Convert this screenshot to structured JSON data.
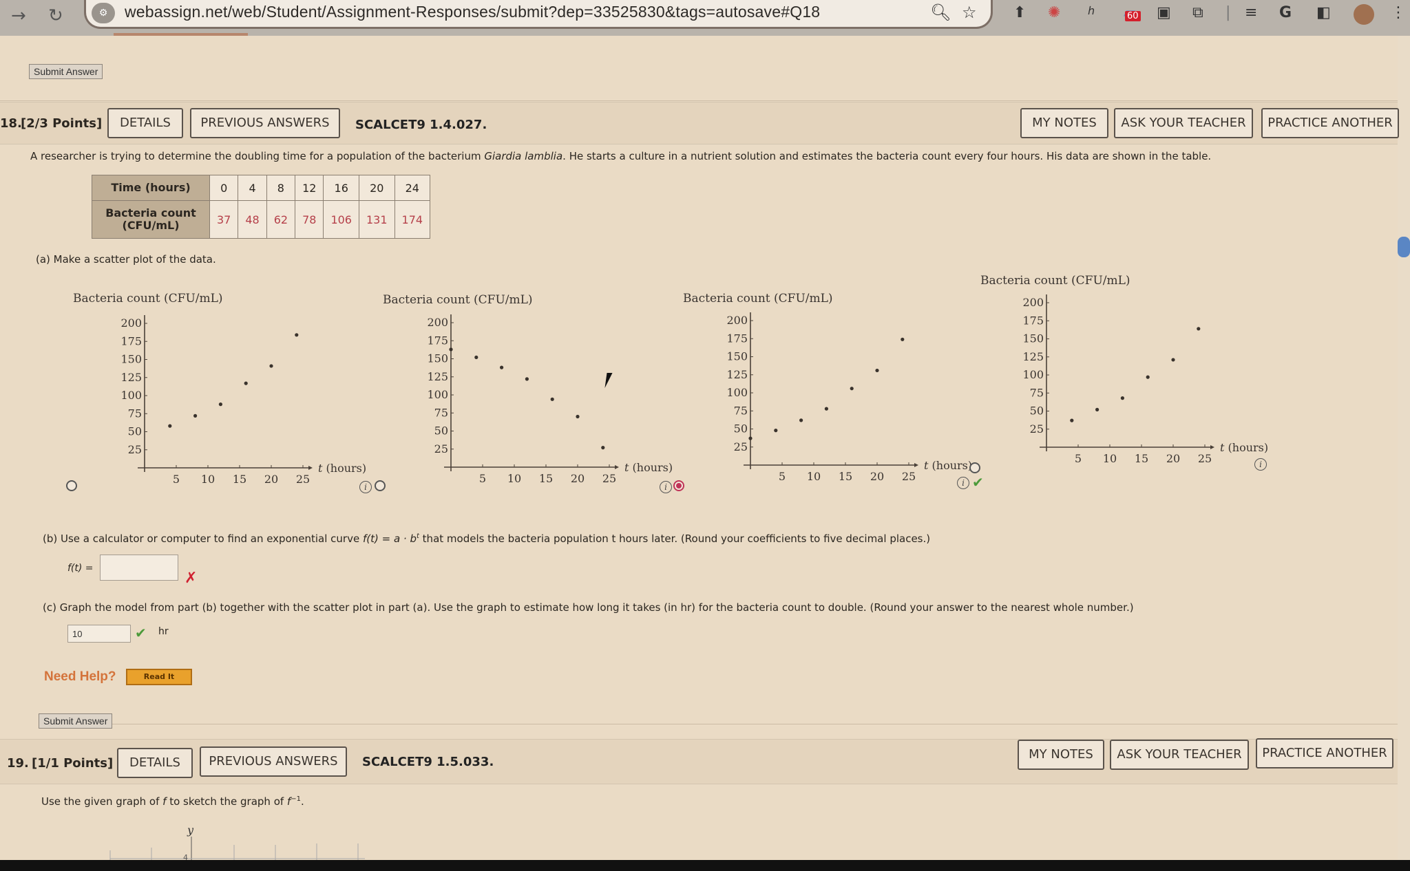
{
  "browser": {
    "url": "webassign.net/web/Student/Assignment-Responses/submit?dep=33525830&tags=autosave#Q18",
    "icons": [
      "back-icon",
      "reload-icon",
      "site-settings-icon",
      "zoom-icon",
      "bookmark-star-icon"
    ],
    "extensions": [
      "upload-extension-icon",
      "pc-extension-icon",
      "script-extension-icon",
      "extension-badge-icon",
      "camera-extension-icon",
      "puzzle-extensions-icon",
      "reading-list-icon",
      "google-icon",
      "sidepanel-icon",
      "profile-avatar",
      "menu-dots-icon"
    ],
    "ext_badge": "60"
  },
  "top": {
    "submit_label": "Submit Answer"
  },
  "q18": {
    "number": "18.",
    "points": "[2/3 Points]",
    "details_label": "DETAILS",
    "prev_label": "PREVIOUS ANSWERS",
    "code": "SCALCET9 1.4.027.",
    "my_notes": "MY NOTES",
    "ask_teacher": "ASK YOUR TEACHER",
    "practice": "PRACTICE ANOTHER",
    "intro_pre": "A researcher is trying to determine the doubling time for a population of the bacterium ",
    "intro_species": "Giardia lamblia",
    "intro_post": ". He starts a culture in a nutrient solution and estimates the bacteria count every four hours. His data are shown in the table.",
    "table": {
      "row1_header": "Time (hours)",
      "row2_header_l1": "Bacteria count",
      "row2_header_l2": "(CFU/mL)",
      "times": [
        "0",
        "4",
        "8",
        "12",
        "16",
        "20",
        "24"
      ],
      "counts": [
        "37",
        "48",
        "62",
        "78",
        "106",
        "131",
        "174"
      ]
    },
    "part_a": "(a)   Make a scatter plot of the data.",
    "part_b_pre": "(b)   Use a calculator or computer to find an exponential curve ",
    "part_b_formula": "f(t) = a · b",
    "part_b_sup": "t",
    "part_b_post": " that models the bacteria population t hours later. (Round your coefficients to five decimal places.)",
    "part_b_label": "f(t) =",
    "part_b_value": "",
    "part_b_status": "✗",
    "part_c": "(c)   Graph the model from part (b) together with the scatter plot in part (a). Use the graph to estimate how long it takes (in hr) for the bacteria count to double. (Round your answer to the nearest whole number.)",
    "part_c_value": "10",
    "part_c_status": "✔",
    "part_c_unit": "hr",
    "need_help": "Need Help?",
    "read_it": "Read It",
    "submit_label": "Submit Answer"
  },
  "q19": {
    "number": "19.",
    "points": "[1/1 Points]",
    "details_label": "DETAILS",
    "prev_label": "PREVIOUS ANSWERS",
    "code": "SCALCET9 1.5.033.",
    "my_notes": "MY NOTES",
    "ask_teacher": "ASK YOUR TEACHER",
    "practice": "PRACTICE ANOTHER",
    "prompt_pre": "Use the given graph of ",
    "prompt_f": "f",
    "prompt_mid": " to sketch the graph of ",
    "prompt_finv": "f",
    "prompt_sup": "−1",
    "prompt_end": ".",
    "graph_y_label": "y",
    "graph_tick": "4"
  },
  "chart_data": [
    {
      "type": "scatter",
      "title": "Bacteria count (CFU/mL)",
      "xlabel": "t (hours)",
      "x_ticks": [
        "5",
        "10",
        "15",
        "20",
        "25"
      ],
      "y_ticks": [
        "25",
        "50",
        "75",
        "100",
        "125",
        "150",
        "175",
        "200"
      ],
      "xlim": [
        0,
        25
      ],
      "ylim": [
        0,
        200
      ],
      "x": [
        4,
        8,
        12,
        16,
        20,
        24
      ],
      "y": [
        58,
        72,
        88,
        117,
        141,
        184
      ],
      "selected": false,
      "status": ""
    },
    {
      "type": "scatter",
      "title": "Bacteria count (CFU/mL)",
      "xlabel": "t (hours)",
      "x_ticks": [
        "5",
        "10",
        "15",
        "20",
        "25"
      ],
      "y_ticks": [
        "25",
        "50",
        "75",
        "100",
        "125",
        "150",
        "175",
        "200"
      ],
      "xlim": [
        0,
        25
      ],
      "ylim": [
        0,
        200
      ],
      "x": [
        0,
        4,
        8,
        12,
        16,
        20,
        24
      ],
      "y": [
        163,
        152,
        138,
        122,
        94,
        70,
        27
      ],
      "selected": false,
      "status": ""
    },
    {
      "type": "scatter",
      "title": "Bacteria count (CFU/mL)",
      "xlabel": "t (hours)",
      "x_ticks": [
        "5",
        "10",
        "15",
        "20",
        "25"
      ],
      "y_ticks": [
        "25",
        "50",
        "75",
        "100",
        "125",
        "150",
        "175",
        "200"
      ],
      "xlim": [
        0,
        25
      ],
      "ylim": [
        0,
        200
      ],
      "x": [
        0,
        4,
        8,
        12,
        16,
        20,
        24
      ],
      "y": [
        37,
        48,
        62,
        78,
        106,
        131,
        174
      ],
      "selected": true,
      "status": "correct"
    },
    {
      "type": "scatter",
      "title": "Bacteria count (CFU/mL)",
      "xlabel": "t (hours)",
      "x_ticks": [
        "5",
        "10",
        "15",
        "20",
        "25"
      ],
      "y_ticks": [
        "25",
        "50",
        "75",
        "100",
        "125",
        "150",
        "175",
        "200"
      ],
      "xlim": [
        0,
        25
      ],
      "ylim": [
        0,
        200
      ],
      "x": [
        4,
        8,
        12,
        16,
        20,
        24
      ],
      "y": [
        37,
        52,
        68,
        97,
        121,
        164
      ],
      "selected": false,
      "status": ""
    }
  ]
}
